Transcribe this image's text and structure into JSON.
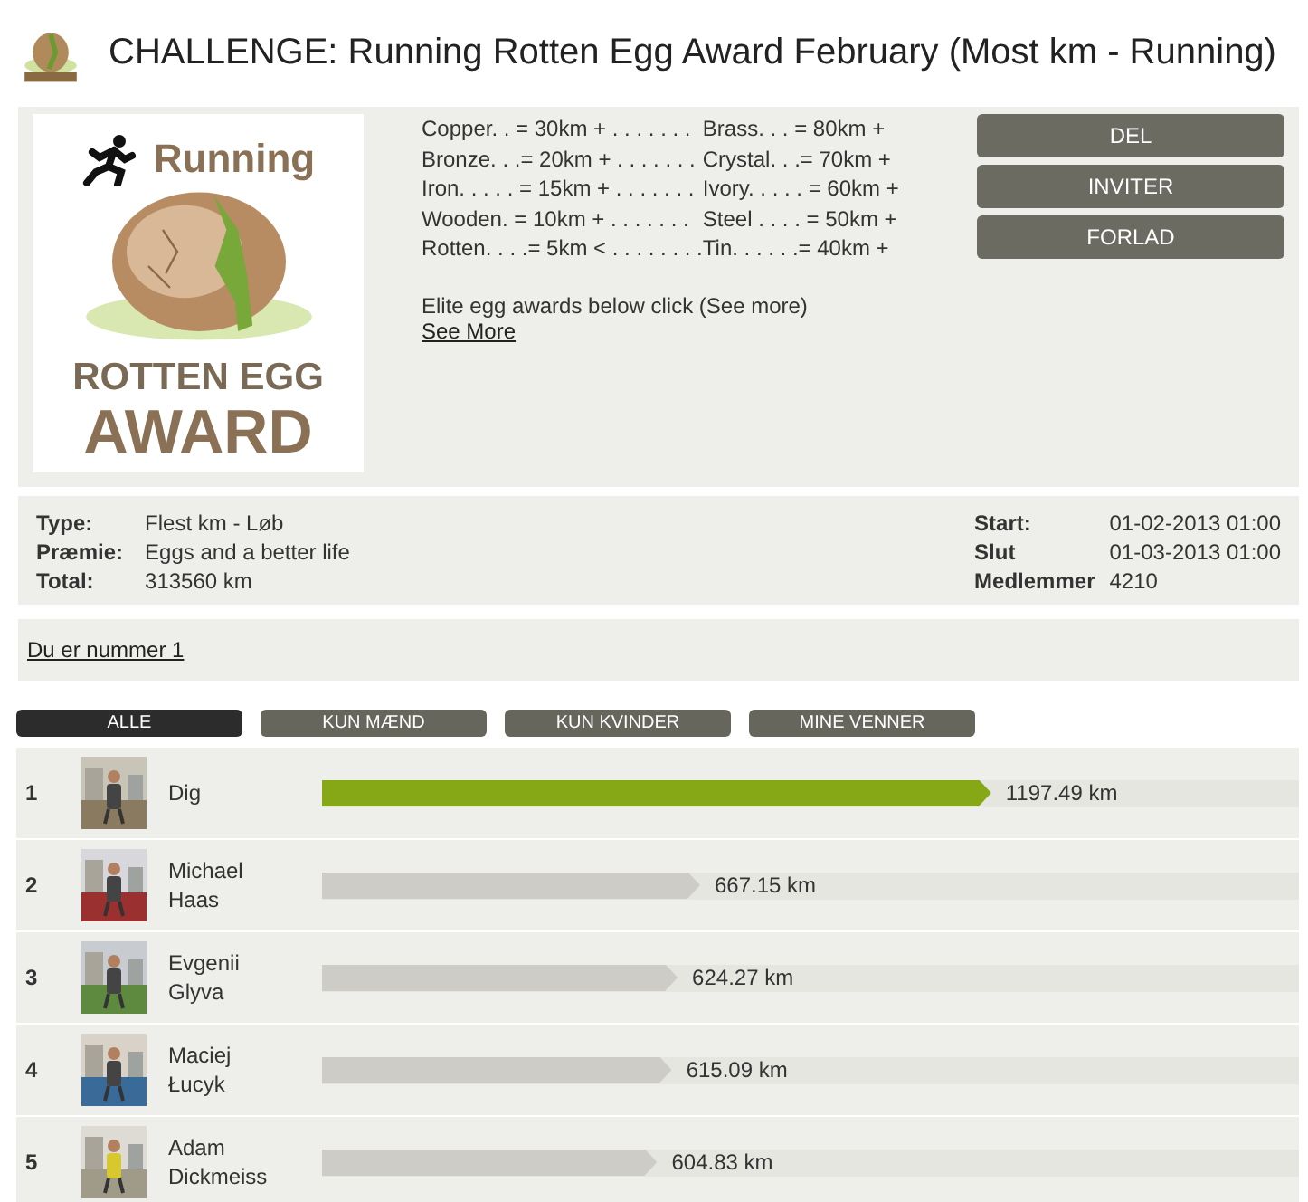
{
  "header": {
    "title": "CHALLENGE:  Running Rotten Egg Award February (Most km - Running)"
  },
  "badge": {
    "top": "Running",
    "middle": "ROTTEN EGG",
    "bottom": "AWARD"
  },
  "awards": [
    {
      "left": "Copper. . = 30km + . . . . . . .",
      "right": "Brass. . . = 80km +"
    },
    {
      "left": "Bronze. . .= 20km + . . . . . . .",
      "right": "Crystal. . .= 70km +"
    },
    {
      "left": "Iron. . . . . = 15km + . . . . . . .",
      "right": "Ivory. . . . . = 60km +"
    },
    {
      "left": "Wooden. = 10km + . . . . . . .",
      "right": "Steel . . . . = 50km +"
    },
    {
      "left": "Rotten. . . .= 5km < . . . . . . . .",
      "right": "Tin. . . . . .= 40km +"
    }
  ],
  "elite_note": "Elite egg awards below click (See more)",
  "see_more": "See More",
  "actions": [
    "DEL",
    "INVITER",
    "FORLAD"
  ],
  "info_left": [
    {
      "label": "Type:",
      "value": "Flest km - Løb"
    },
    {
      "label": "Præmie:",
      "value": "Eggs and a better life"
    },
    {
      "label": "Total:",
      "value": "313560 km"
    }
  ],
  "info_right": [
    {
      "label": "Start:",
      "value": "01-02-2013 01:00"
    },
    {
      "label": "Slut",
      "value": "01-03-2013 01:00"
    },
    {
      "label": "Medlemmer",
      "value": "4210"
    }
  ],
  "rank_link": "Du er nummer 1",
  "filters": [
    {
      "label": "ALLE",
      "selected": true
    },
    {
      "label": "KUN MÆND",
      "selected": false
    },
    {
      "label": "KUN KVINDER",
      "selected": false
    },
    {
      "label": "MINE VENNER",
      "selected": false
    }
  ],
  "rows": [
    {
      "rank": "1",
      "first": "Dig",
      "last": "",
      "distance": "1197.49 km",
      "level": 0.685,
      "color": "#86a817"
    },
    {
      "rank": "2",
      "first": "Michael",
      "last": "Haas",
      "distance": "667.15 km",
      "level": 0.387,
      "color": "#cdccc6"
    },
    {
      "rank": "3",
      "first": "Evgenii",
      "last": "Glyva",
      "distance": "624.27 km",
      "level": 0.364,
      "color": "#cdccc6"
    },
    {
      "rank": "4",
      "first": "Maciej",
      "last": "Łucyk",
      "distance": "615.09 km",
      "level": 0.358,
      "color": "#cdccc6"
    },
    {
      "rank": "5",
      "first": "Adam",
      "last": "Dickmeiss",
      "distance": "604.83 km",
      "level": 0.343,
      "color": "#cdccc6"
    }
  ]
}
